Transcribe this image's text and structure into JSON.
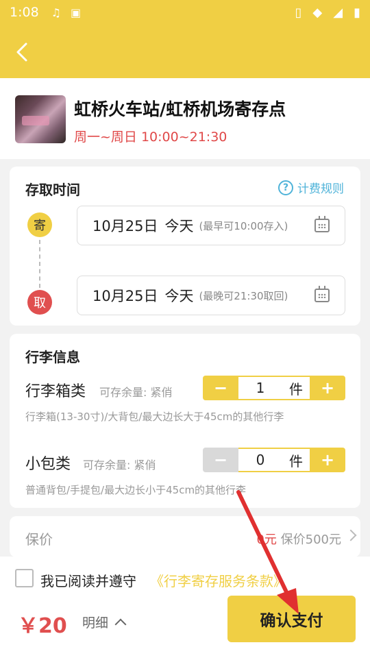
{
  "status_bar": {
    "time": "1:08"
  },
  "store": {
    "name": "虹桥火车站/虹桥机场寄存点",
    "hours": "周一~周日 10:00~21:30"
  },
  "time_section": {
    "title": "存取时间",
    "fee_rule": "计费规则",
    "store_badge": "寄",
    "pick_badge": "取",
    "store_date": "10月25日",
    "store_day": "今天",
    "store_hint": "(最早可10:00存入)",
    "pick_date": "10月25日",
    "pick_day": "今天",
    "pick_hint": "(最晚可21:30取回)"
  },
  "luggage_section": {
    "title": "行李信息",
    "items": [
      {
        "name": "行李箱类",
        "capacity": "可存余量: 紧俏",
        "qty": "1",
        "unit": "件",
        "desc": "行李箱(13-30寸)/大背包/最大边长大于45cm的其他行李"
      },
      {
        "name": "小包类",
        "capacity": "可存余量: 紧俏",
        "qty": "0",
        "unit": "件",
        "desc": "普通背包/手提包/最大边长小于45cm的其他行李"
      }
    ]
  },
  "insurance": {
    "label": "保价",
    "price": "0元",
    "coverage": "保价500元"
  },
  "footer": {
    "agree_text": "我已阅读并遵守",
    "terms_link": "《行李寄存服务条款》",
    "price": "￥20",
    "detail": "明细",
    "pay_button": "确认支付"
  },
  "colors": {
    "brand_yellow": "#f0cf44",
    "price_red": "#e04848",
    "link_blue": "#4fb3d9",
    "annotation_red": "#e03030"
  }
}
